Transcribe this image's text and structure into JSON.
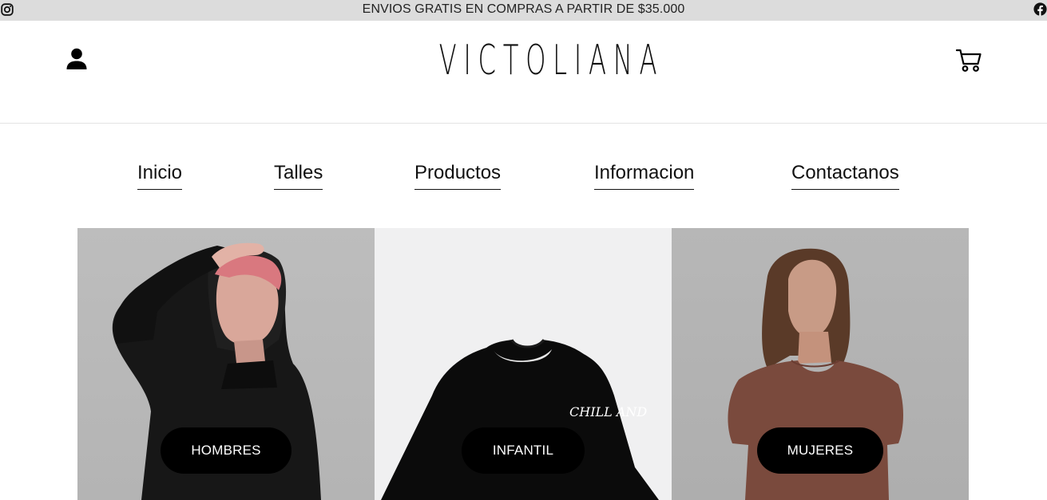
{
  "topbar": {
    "announcement": "ENVIOS GRATIS EN COMPRAS A PARTIR DE $35.000",
    "left_icon": "instagram-icon",
    "right_icon": "facebook-icon"
  },
  "header": {
    "logo_text": "VICTOLIANA",
    "account_icon": "user-icon",
    "cart_icon": "cart-icon"
  },
  "nav": {
    "items": [
      {
        "label": "Inicio"
      },
      {
        "label": "Talles"
      },
      {
        "label": "Productos"
      },
      {
        "label": "Informacion"
      },
      {
        "label": "Contactanos"
      }
    ]
  },
  "categories": [
    {
      "label": "HOMBRES"
    },
    {
      "label": "INFANTIL",
      "shirt_print": "CHILL AND"
    },
    {
      "label": "MUJERES"
    }
  ],
  "colors": {
    "topbar_bg": "#dcdcdc",
    "pill_bg": "#000000",
    "pill_text": "#ffffff"
  }
}
